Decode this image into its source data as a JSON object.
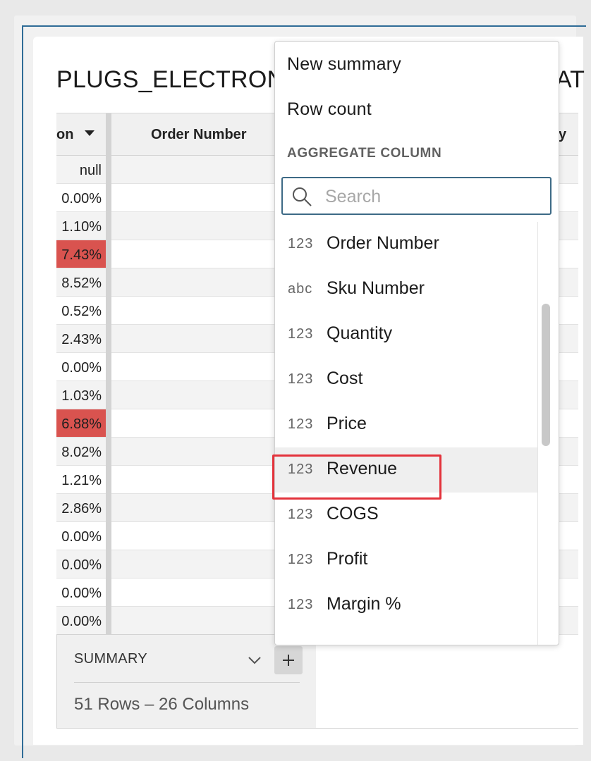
{
  "title": {
    "left": "PLUGS_ELECTRON",
    "right": "AT"
  },
  "table": {
    "col1_header": "on",
    "col2_header": "Order Number",
    "col3_header_partial": "y",
    "col1_values": [
      "null",
      "0.00%",
      "1.10%",
      "7.43%",
      "8.52%",
      "0.52%",
      "2.43%",
      "0.00%",
      "1.03%",
      "6.88%",
      "8.02%",
      "1.21%",
      "2.86%",
      "0.00%",
      "0.00%",
      "0.00%",
      "0.00%"
    ],
    "highlighted_rows": [
      3,
      9
    ],
    "highlight_color": "#d9534f"
  },
  "footer": {
    "summary_label": "SUMMARY",
    "row_info": "51 Rows – 26 Columns",
    "add_icon": "plus-icon",
    "expand_icon": "chevron-down-icon"
  },
  "menu": {
    "new_summary": "New summary",
    "row_count": "Row count",
    "section_label": "AGGREGATE COLUMN",
    "search_placeholder": "Search",
    "options": [
      {
        "type": "123",
        "label": "Order Number"
      },
      {
        "type": "abc",
        "label": "Sku Number"
      },
      {
        "type": "123",
        "label": "Quantity"
      },
      {
        "type": "123",
        "label": "Cost"
      },
      {
        "type": "123",
        "label": "Price"
      },
      {
        "type": "123",
        "label": "Revenue"
      },
      {
        "type": "123",
        "label": "COGS"
      },
      {
        "type": "123",
        "label": "Profit"
      },
      {
        "type": "123",
        "label": "Margin %"
      }
    ],
    "highlighted_option": "Revenue",
    "annotation_color": "#e3323b"
  }
}
